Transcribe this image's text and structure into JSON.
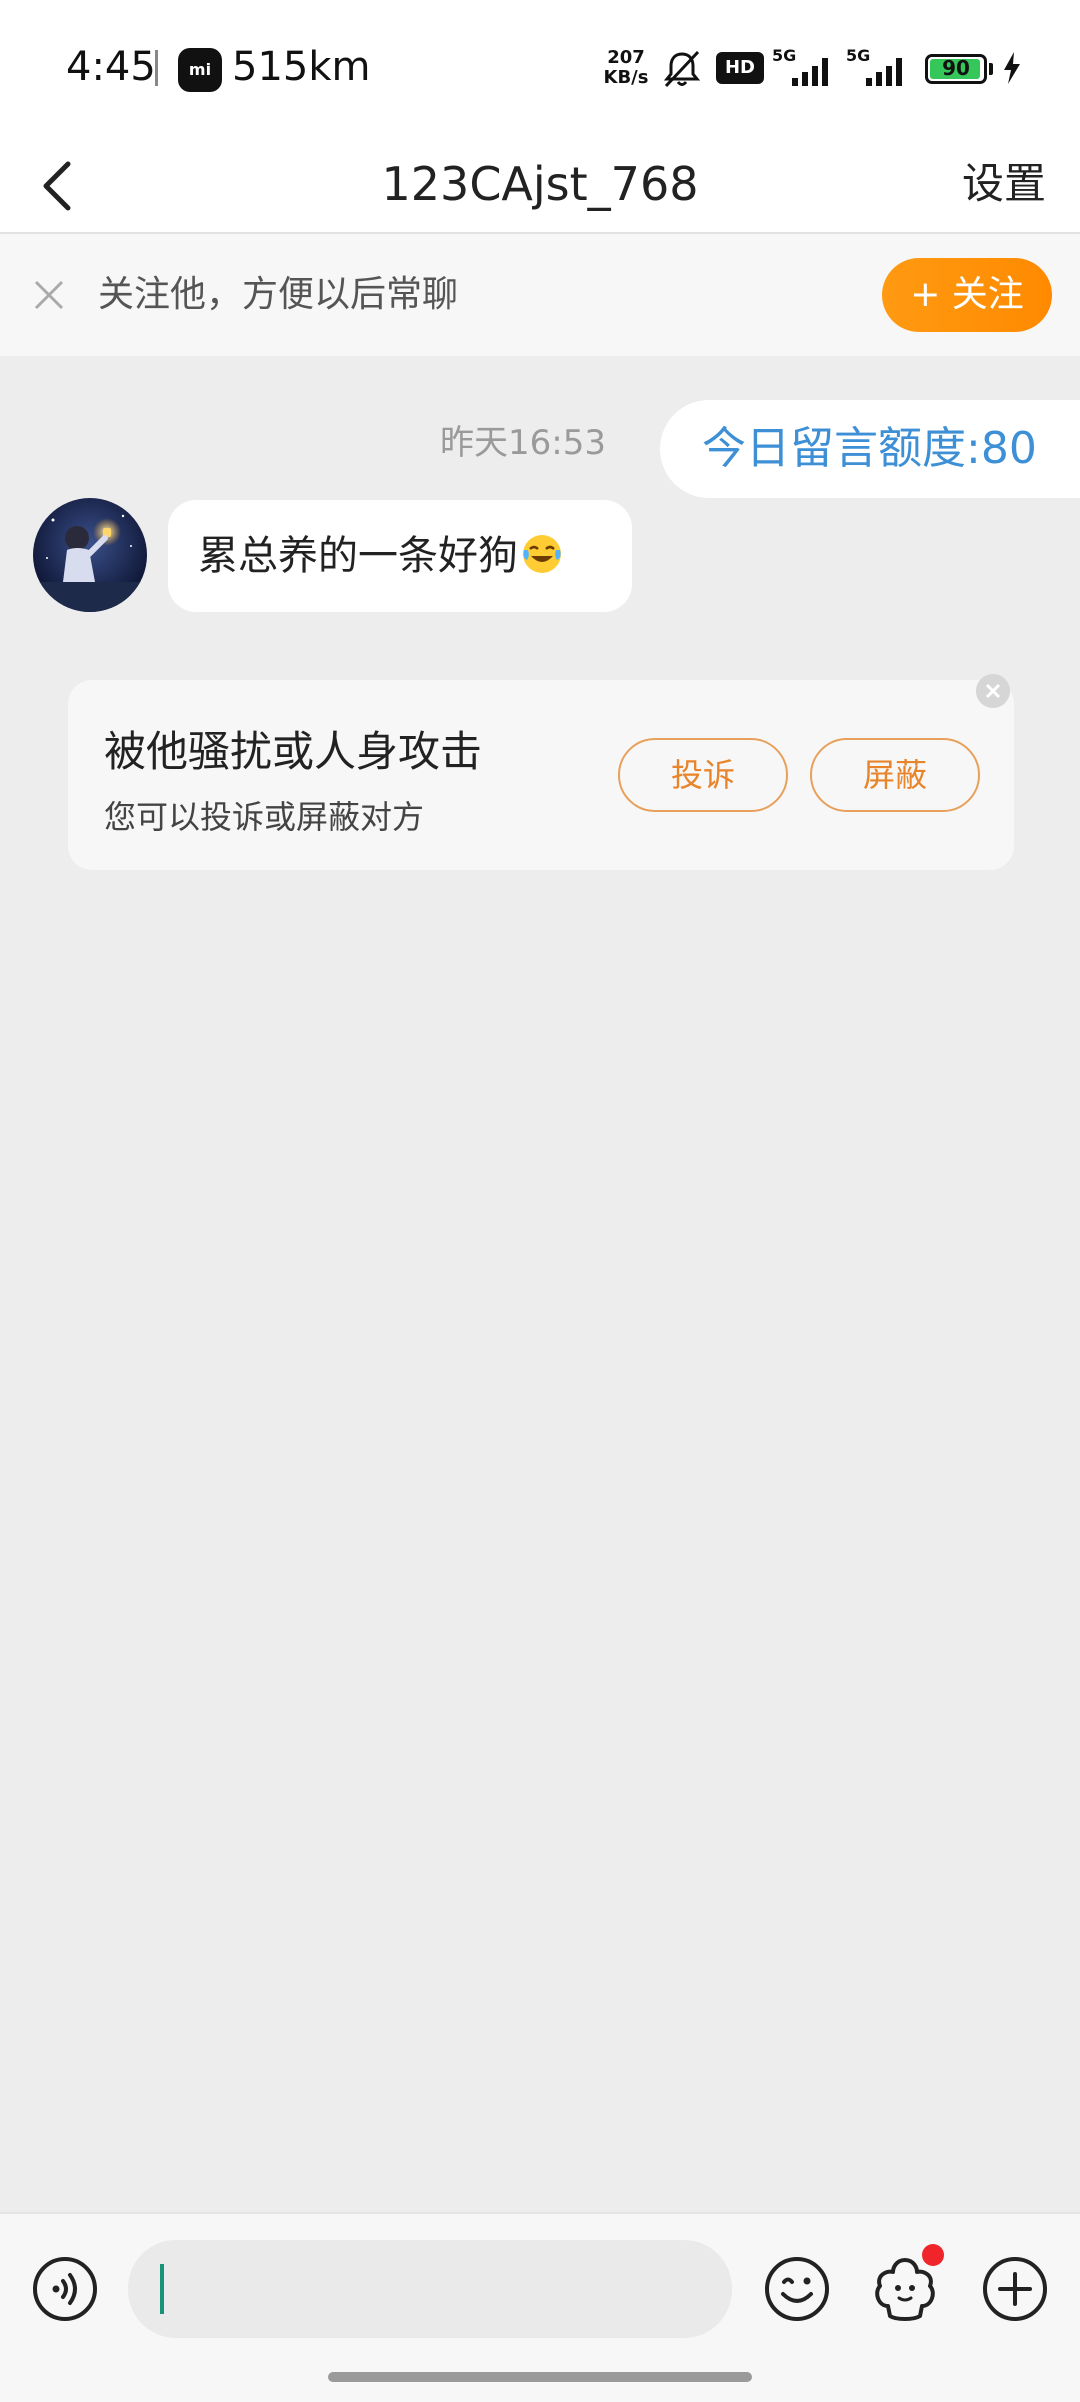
{
  "status_bar": {
    "time": "4:45",
    "app_badge": "mi",
    "distance": "515km",
    "net_speed_value": "207",
    "net_speed_unit": "KB/s",
    "hd_label": "HD",
    "signal1_label": "5G",
    "signal2_label": "5G",
    "battery": "90"
  },
  "nav": {
    "title": "123CAjst_768",
    "settings_label": "设置"
  },
  "follow_banner": {
    "text": "关注他，方便以后常聊",
    "button_label": "+ 关注"
  },
  "chat": {
    "timestamp": "昨天16:53",
    "quota_message": "今日留言额度:80",
    "incoming_message": "累总养的一条好狗"
  },
  "harass_card": {
    "title": "被他骚扰或人身攻击",
    "subtitle": "您可以投诉或屏蔽对方",
    "complain_label": "投诉",
    "block_label": "屏蔽"
  },
  "colors": {
    "accent_orange": "#ff8a00",
    "link_blue": "#3d8fd6",
    "caret_green": "#18937a",
    "badge_red": "#f0252c"
  }
}
